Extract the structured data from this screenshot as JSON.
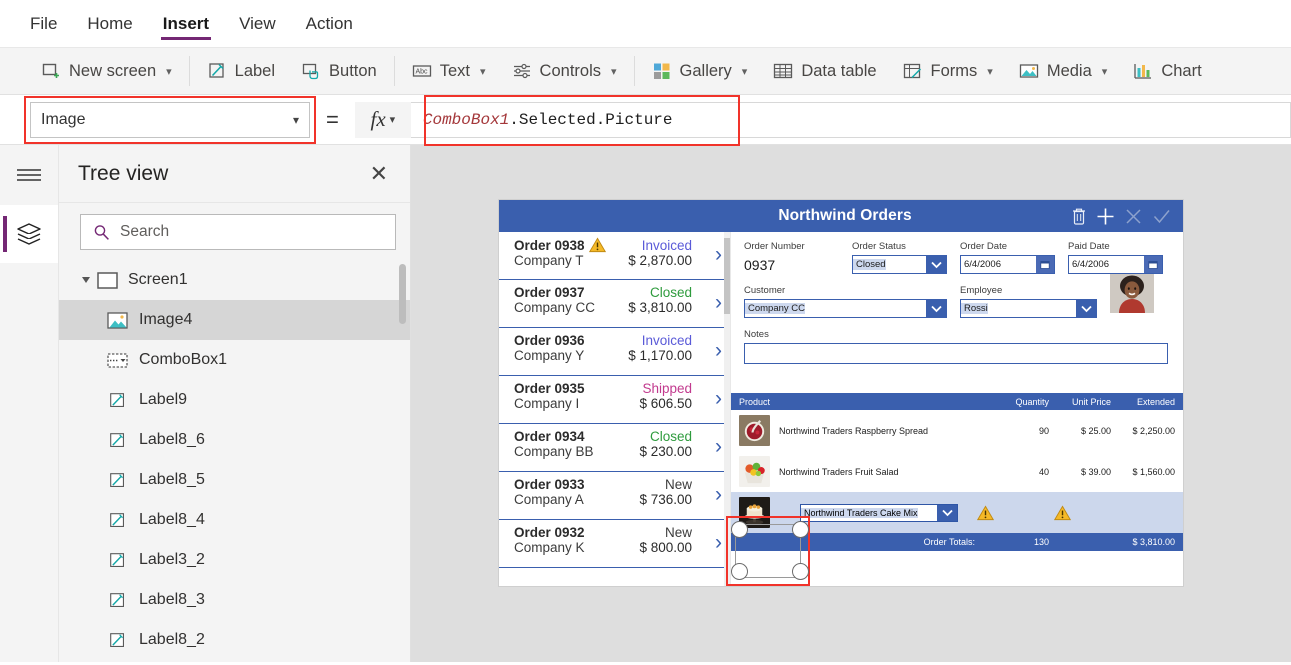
{
  "menubar": {
    "items": [
      {
        "label": "File",
        "active": false
      },
      {
        "label": "Home",
        "active": false
      },
      {
        "label": "Insert",
        "active": true
      },
      {
        "label": "View",
        "active": false
      },
      {
        "label": "Action",
        "active": false
      }
    ]
  },
  "ribbon": {
    "items": [
      {
        "label": "New screen",
        "icon": "new-screen-icon",
        "caret": true
      },
      {
        "label": "Label",
        "icon": "label-icon",
        "caret": false
      },
      {
        "label": "Button",
        "icon": "button-icon",
        "caret": false
      },
      {
        "label": "Text",
        "icon": "text-abc-icon",
        "caret": true
      },
      {
        "label": "Controls",
        "icon": "controls-sliders-icon",
        "caret": true
      },
      {
        "label": "Gallery",
        "icon": "gallery-icon",
        "caret": true
      },
      {
        "label": "Data table",
        "icon": "data-table-icon",
        "caret": false
      },
      {
        "label": "Forms",
        "icon": "forms-icon",
        "caret": true
      },
      {
        "label": "Media",
        "icon": "media-icon",
        "caret": true
      },
      {
        "label": "Chart",
        "icon": "chart-icon",
        "caret": false
      }
    ]
  },
  "formula_bar": {
    "property_value": "Image",
    "equals": "=",
    "fx_label": "fx",
    "formula_identifier": "ComboBox1",
    "formula_rest": ".Selected.Picture",
    "formula_full": "ComboBox1.Selected.Picture"
  },
  "tree_view": {
    "title": "Tree view",
    "close_label": "✕",
    "search_placeholder": "Search",
    "items": [
      {
        "label": "Screen1",
        "icon": "screen-icon",
        "level": 0,
        "selected": false,
        "expanded": true
      },
      {
        "label": "Image4",
        "icon": "image-icon",
        "level": 1,
        "selected": true
      },
      {
        "label": "ComboBox1",
        "icon": "combobox-icon",
        "level": 1,
        "selected": false
      },
      {
        "label": "Label9",
        "icon": "label-icon",
        "level": 1,
        "selected": false
      },
      {
        "label": "Label8_6",
        "icon": "label-icon",
        "level": 1,
        "selected": false
      },
      {
        "label": "Label8_5",
        "icon": "label-icon",
        "level": 1,
        "selected": false
      },
      {
        "label": "Label8_4",
        "icon": "label-icon",
        "level": 1,
        "selected": false
      },
      {
        "label": "Label3_2",
        "icon": "label-icon",
        "level": 1,
        "selected": false
      },
      {
        "label": "Label8_3",
        "icon": "label-icon",
        "level": 1,
        "selected": false
      },
      {
        "label": "Label8_2",
        "icon": "label-icon",
        "level": 1,
        "selected": false
      }
    ]
  },
  "app": {
    "title": "Northwind Orders",
    "header_actions": [
      {
        "name": "delete-icon"
      },
      {
        "name": "add-icon"
      },
      {
        "name": "cancel-icon"
      },
      {
        "name": "confirm-icon"
      }
    ],
    "orders": [
      {
        "order": "Order 0938",
        "company": "Company T",
        "status": "Invoiced",
        "amount": "$ 2,870.00",
        "status_color": "#5a5ad8",
        "warning": true
      },
      {
        "order": "Order 0937",
        "company": "Company CC",
        "status": "Closed",
        "amount": "$ 3,810.00",
        "status_color": "#2e9b3d",
        "warning": false
      },
      {
        "order": "Order 0936",
        "company": "Company Y",
        "status": "Invoiced",
        "amount": "$ 1,170.00",
        "status_color": "#5a5ad8",
        "warning": false
      },
      {
        "order": "Order 0935",
        "company": "Company I",
        "status": "Shipped",
        "amount": "$ 606.50",
        "status_color": "#c23a8e",
        "warning": false
      },
      {
        "order": "Order 0934",
        "company": "Company BB",
        "status": "Closed",
        "amount": "$ 230.00",
        "status_color": "#2e9b3d",
        "warning": false
      },
      {
        "order": "Order 0933",
        "company": "Company A",
        "status": "New",
        "amount": "$ 736.00",
        "status_color": "#3c3c3c",
        "warning": false
      },
      {
        "order": "Order 0932",
        "company": "Company K",
        "status": "New",
        "amount": "$ 800.00",
        "status_color": "#3c3c3c",
        "warning": false
      }
    ],
    "form": {
      "order_number_label": "Order Number",
      "order_number_value": "0937",
      "order_status_label": "Order Status",
      "order_status_value": "Closed",
      "order_date_label": "Order Date",
      "order_date_value": "6/4/2006",
      "paid_date_label": "Paid Date",
      "paid_date_value": "6/4/2006",
      "customer_label": "Customer",
      "customer_value": "Company CC",
      "employee_label": "Employee",
      "employee_value": "Rossi",
      "notes_label": "Notes",
      "notes_value": ""
    },
    "products_table": {
      "headers": [
        "Product",
        "Quantity",
        "Unit Price",
        "Extended"
      ],
      "rows": [
        {
          "product": "Northwind Traders Raspberry Spread",
          "quantity": "90",
          "unit_price": "$ 25.00",
          "extended": "$ 2,250.00"
        },
        {
          "product": "Northwind Traders Fruit Salad",
          "quantity": "40",
          "unit_price": "$ 39.00",
          "extended": "$ 1,560.00"
        }
      ],
      "new_row_product": "Northwind Traders Cake Mix",
      "totals_label": "Order Totals:",
      "totals_quantity": "130",
      "totals_amount": "$ 3,810.00"
    }
  },
  "colors": {
    "accent_purple": "#742774",
    "app_blue": "#3a5fae",
    "selection_red": "#f1332a",
    "canvas_gray": "#dedede"
  }
}
